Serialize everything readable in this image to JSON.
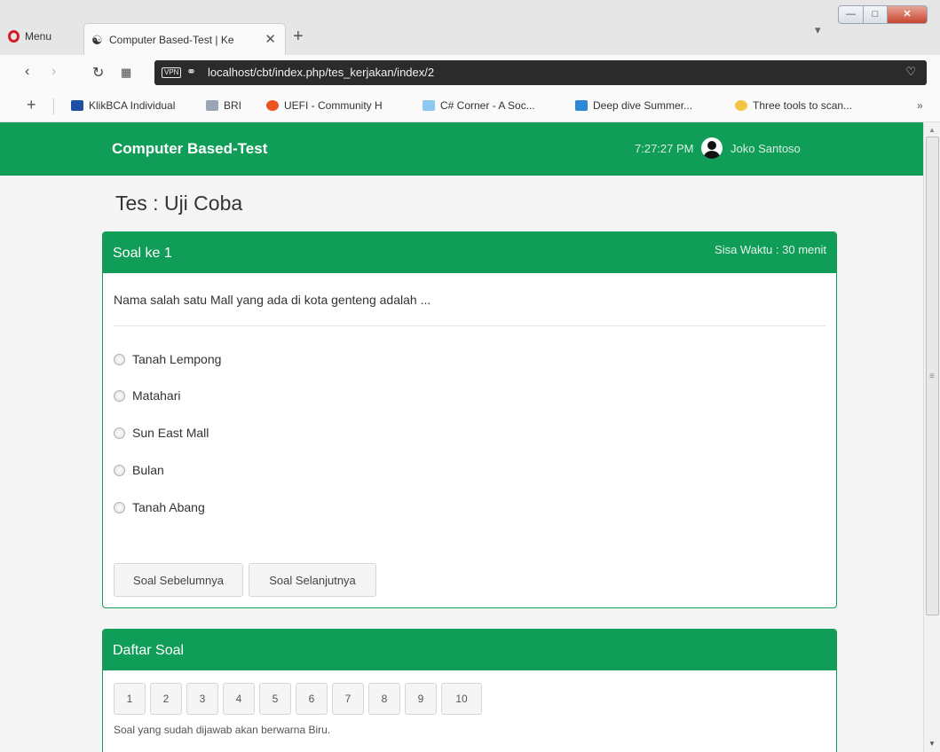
{
  "browser": {
    "menu_label": "Menu",
    "tab_title": "Computer Based-Test | Ke",
    "url": "localhost/cbt/index.php/tes_kerjakan/index/2",
    "vpn_label": "VPN",
    "bookmarks": [
      {
        "label": "KlikBCA Individual",
        "color": "#1f4fa3"
      },
      {
        "label": "BRI",
        "color": "#9aa6b5"
      },
      {
        "label": "UEFI - Community H",
        "color": "#e95420"
      },
      {
        "label": "C# Corner - A Soc...",
        "color": "#8ec8f0"
      },
      {
        "label": "Deep dive Summer...",
        "color": "#2f87d8"
      },
      {
        "label": "Three tools to scan...",
        "color": "#f4c542"
      }
    ]
  },
  "navbar": {
    "brand": "Computer Based-Test",
    "time": "7:27:27 PM",
    "user": "Joko Santoso"
  },
  "test": {
    "title": "Tes : Uji Coba"
  },
  "question_panel": {
    "title": "Soal ke 1",
    "timer": "Sisa Waktu : 30 menit",
    "question": "Nama salah satu Mall yang ada di kota genteng adalah ...",
    "options": [
      "Tanah Lempong",
      "Matahari",
      "Sun East Mall",
      "Bulan",
      "Tanah Abang"
    ],
    "prev_label": "Soal Sebelumnya",
    "next_label": "Soal Selanjutnya"
  },
  "list_panel": {
    "title": "Daftar Soal",
    "numbers": [
      "1",
      "2",
      "3",
      "4",
      "5",
      "6",
      "7",
      "8",
      "9",
      "10"
    ],
    "note": "Soal yang sudah dijawab akan berwarna Biru."
  },
  "theme": {
    "primary": "#0f9d58"
  }
}
